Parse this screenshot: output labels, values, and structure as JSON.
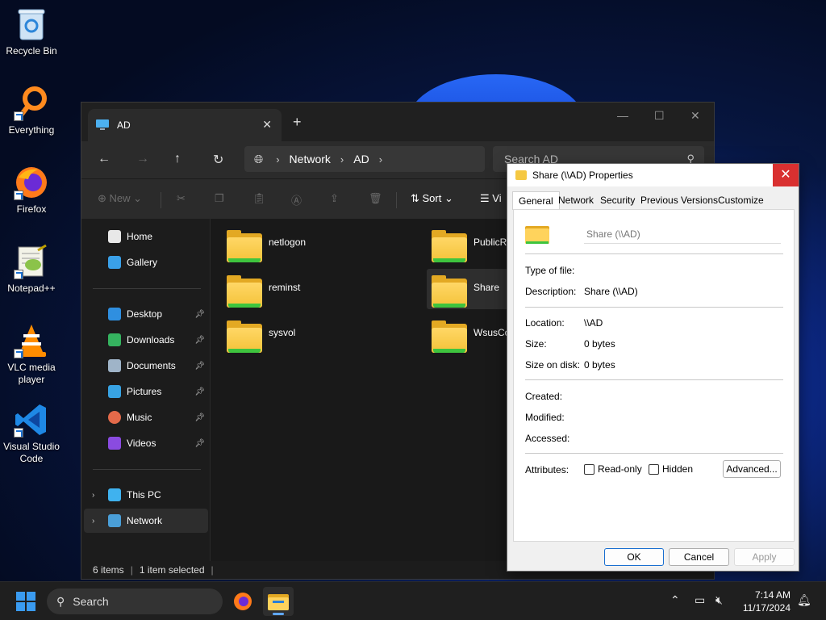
{
  "desktop": {
    "icons": [
      {
        "label": "Recycle Bin"
      },
      {
        "label": "Everything"
      },
      {
        "label": "Firefox"
      },
      {
        "label": "Notepad++"
      },
      {
        "label": "VLC media player"
      },
      {
        "label": "Visual Studio Code"
      }
    ]
  },
  "explorer": {
    "tab_title": "AD",
    "address": {
      "crumbs": [
        "Network",
        "AD"
      ]
    },
    "search_placeholder": "Search AD",
    "cmd": {
      "new": "New",
      "sort": "Sort",
      "view": "Vi"
    },
    "nav": {
      "home": "Home",
      "gallery": "Gallery",
      "desktop": "Desktop",
      "downloads": "Downloads",
      "documents": "Documents",
      "pictures": "Pictures",
      "music": "Music",
      "videos": "Videos",
      "this_pc": "This PC",
      "network": "Network"
    },
    "files": [
      {
        "name": "netlogon"
      },
      {
        "name": "PublicRe"
      },
      {
        "name": "reminst"
      },
      {
        "name": "Share"
      },
      {
        "name": "sysvol"
      },
      {
        "name": "WsusCo"
      }
    ],
    "status": {
      "count": "6 items",
      "selected": "1 item selected"
    }
  },
  "dialog": {
    "title": "Share (\\\\AD) Properties",
    "tabs": [
      "General",
      "Network",
      "Security",
      "Previous Versions",
      "Customize"
    ],
    "name_value": "Share (\\\\AD)",
    "labels": {
      "type": "Type of file:",
      "description": "Description:",
      "location": "Location:",
      "size": "Size:",
      "size_on_disk": "Size on disk:",
      "created": "Created:",
      "modified": "Modified:",
      "accessed": "Accessed:",
      "attributes": "Attributes:"
    },
    "values": {
      "description": "Share (\\\\AD)",
      "location": "\\\\AD",
      "size": "0 bytes",
      "size_on_disk": "0 bytes"
    },
    "checkboxes": {
      "readonly": "Read-only",
      "hidden": "Hidden"
    },
    "buttons": {
      "advanced": "Advanced...",
      "ok": "OK",
      "cancel": "Cancel",
      "apply": "Apply"
    }
  },
  "taskbar": {
    "search_label": "Search",
    "time": "7:14 AM",
    "date": "11/17/2024"
  },
  "colors": {
    "accent": "#1a6fd0",
    "close_red": "#d93030",
    "folder": "#f6c641"
  }
}
